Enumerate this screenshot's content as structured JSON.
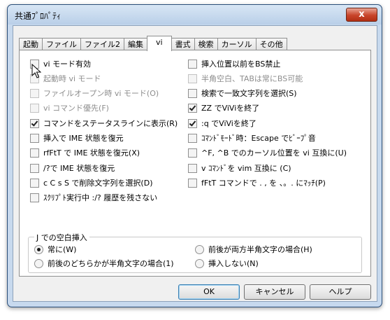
{
  "window": {
    "title": "共通ﾌﾟﾛﾊﾟﾃｨ",
    "close_label": "x"
  },
  "tabs": [
    "起動",
    "ファイル",
    "ファイル2",
    "編集",
    "vi",
    "書式",
    "検索",
    "カーソル",
    "その他"
  ],
  "active_tab": "vi",
  "left_options": [
    {
      "label": "vi モード有効",
      "checked": false,
      "enabled": true
    },
    {
      "label": "起動時 vi モード",
      "checked": false,
      "enabled": false
    },
    {
      "label": "ファイルオープン時 vi モード(O)",
      "checked": false,
      "enabled": false
    },
    {
      "label": "vi コマンド優先(F)",
      "checked": false,
      "enabled": false
    },
    {
      "label": "コマンドをステータスラインに表示(R)",
      "checked": true,
      "enabled": true
    },
    {
      "label": "挿入で IME 状態を復元",
      "checked": false,
      "enabled": true
    },
    {
      "label": "rfFtT で IME 状態を復元(X)",
      "checked": false,
      "enabled": true
    },
    {
      "label": "/?で IME 状態を復元",
      "checked": false,
      "enabled": true
    },
    {
      "label": "c C s S で削除文字列を選択(D)",
      "checked": false,
      "enabled": true
    },
    {
      "label": "ｽｸﾘﾌﾟﾄ実行中 :/? 履歴を残さない",
      "checked": false,
      "enabled": true
    }
  ],
  "right_options": [
    {
      "label": "挿入位置以前をBS禁止",
      "checked": false,
      "enabled": true
    },
    {
      "label": "半角空白、TABは常にBS可能",
      "checked": false,
      "enabled": false
    },
    {
      "label": "検索で一致文字列を選択(S)",
      "checked": false,
      "enabled": true
    },
    {
      "label": "ZZ でViViを終了",
      "checked": true,
      "enabled": true
    },
    {
      "label": ":q でViViを終了",
      "checked": true,
      "enabled": true
    },
    {
      "label": "ｺﾏﾝﾄﾞﾓｰﾄﾞ時：Escape でﾋﾞｰﾌﾟ音",
      "checked": false,
      "enabled": true
    },
    {
      "label": "^F, ^B でのカーソル位置を vi 互換に(U)",
      "checked": false,
      "enabled": true
    },
    {
      "label": "v ｺﾏﾝﾄﾞを vim 互換に (C)",
      "checked": false,
      "enabled": true
    },
    {
      "label": "fFtT コマンドで . , を 、。. にﾏｯﾁ(P)",
      "checked": false,
      "enabled": true
    }
  ],
  "group": {
    "label": "J での空白挿入",
    "options": [
      {
        "label": "常に(W)",
        "checked": true
      },
      {
        "label": "前後が両方半角文字の場合(H)",
        "checked": false
      },
      {
        "label": "前後のどちらかが半角文字の場合(1)",
        "checked": false
      },
      {
        "label": "挿入しない(N)",
        "checked": false
      }
    ]
  },
  "buttons": {
    "ok": "OK",
    "cancel": "キャンセル",
    "help": "ヘルプ"
  }
}
